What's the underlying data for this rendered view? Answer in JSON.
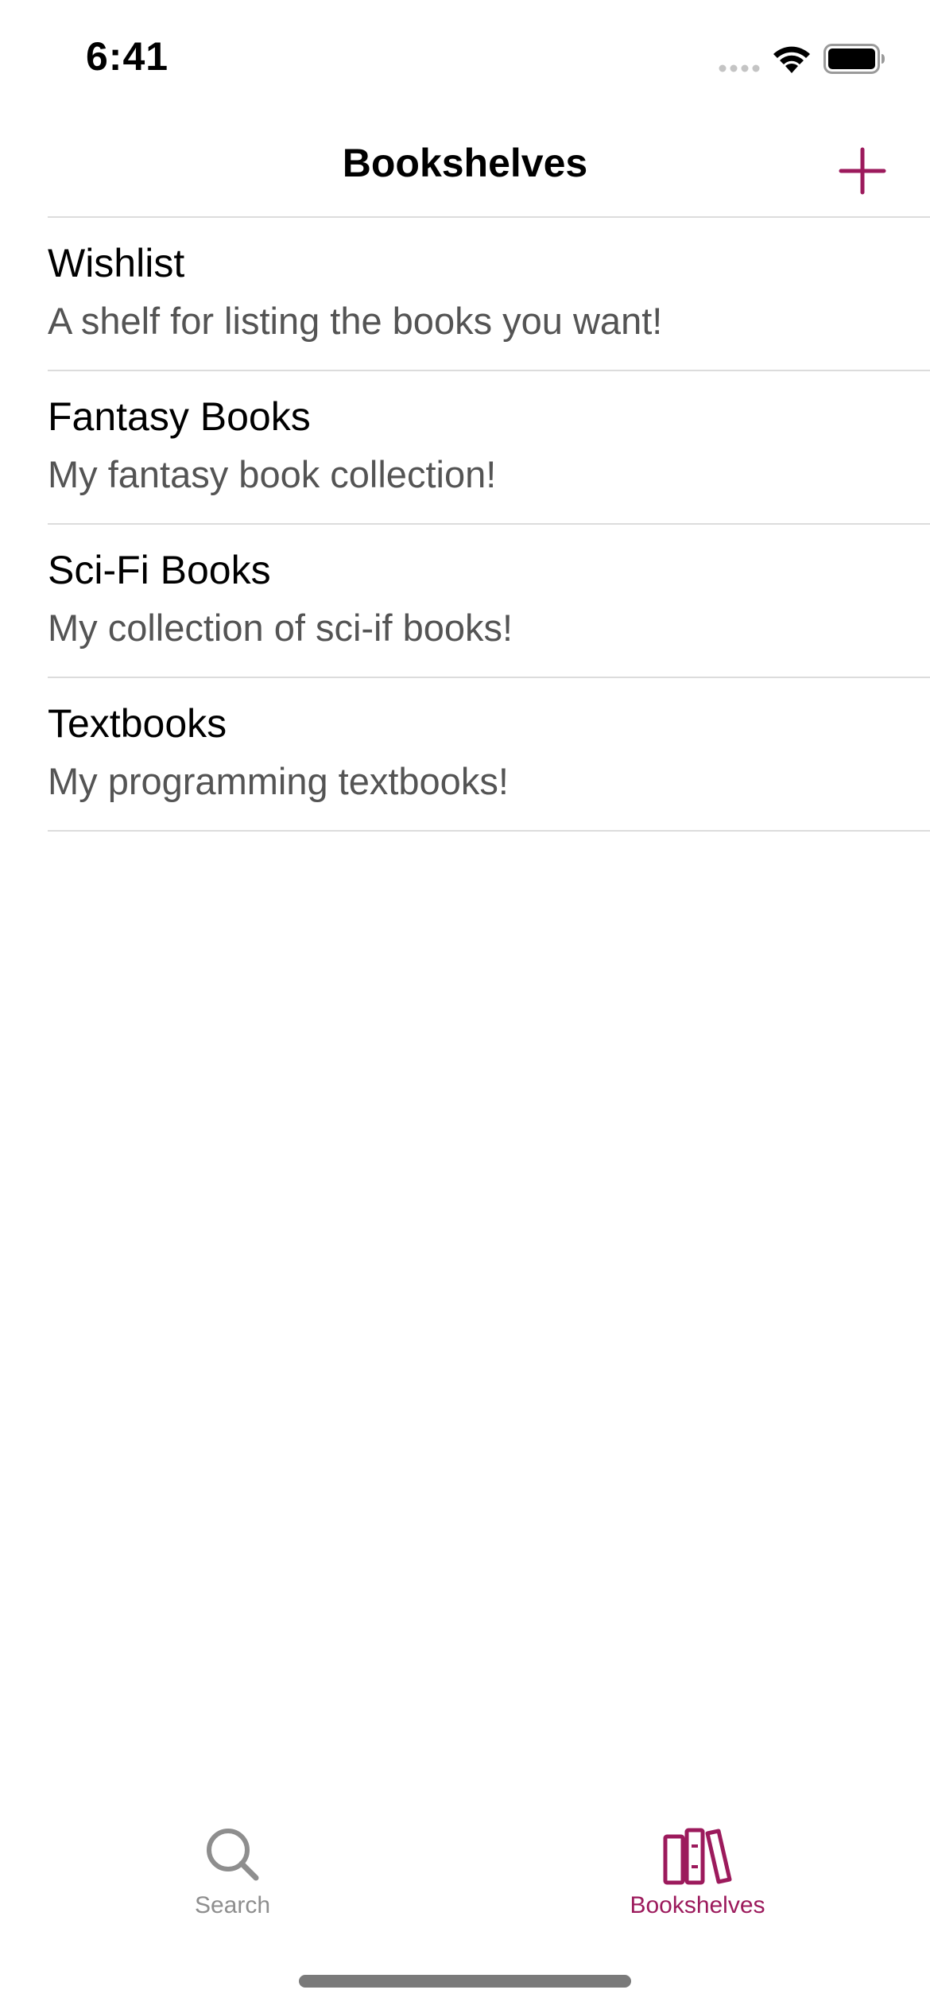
{
  "status_bar": {
    "time": "6:41"
  },
  "nav": {
    "title": "Bookshelves",
    "add_icon": "plus-icon"
  },
  "shelves": [
    {
      "name": "Wishlist",
      "description": "A shelf for listing the books you want!"
    },
    {
      "name": "Fantasy Books",
      "description": "My fantasy book collection!"
    },
    {
      "name": "Sci-Fi Books",
      "description": "My collection of sci-if books!"
    },
    {
      "name": "Textbooks",
      "description": "My programming textbooks!"
    }
  ],
  "tabs": [
    {
      "label": "Search",
      "icon": "magnifying-glass-icon",
      "selected": false
    },
    {
      "label": "Bookshelves",
      "icon": "books-icon",
      "selected": true
    }
  ],
  "colors": {
    "accent": "#9c1a5c",
    "inactive_tab": "#8e8e8e",
    "secondary_text": "#545454",
    "divider": "#dcdcdc"
  }
}
